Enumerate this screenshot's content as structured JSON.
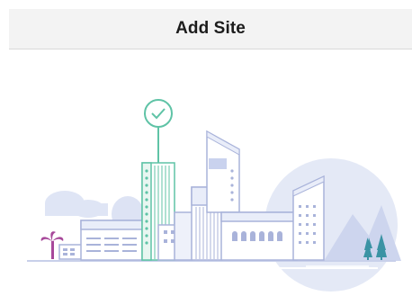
{
  "header": {
    "title": "Add Site"
  },
  "illustration": {
    "name": "city-skyline-illustration",
    "icons": [
      "checkmark-pin-icon",
      "palm-tree-icon",
      "pine-tree-icon",
      "mountain-icon",
      "cloud-icon"
    ],
    "colors": {
      "accent_green": "#5fc3a6",
      "building_fill": "#e9edf9",
      "building_stroke": "#a9b3da",
      "circle_bg": "#e4e9f6",
      "palm": "#a7489a",
      "pine": "#3a93a4"
    }
  }
}
